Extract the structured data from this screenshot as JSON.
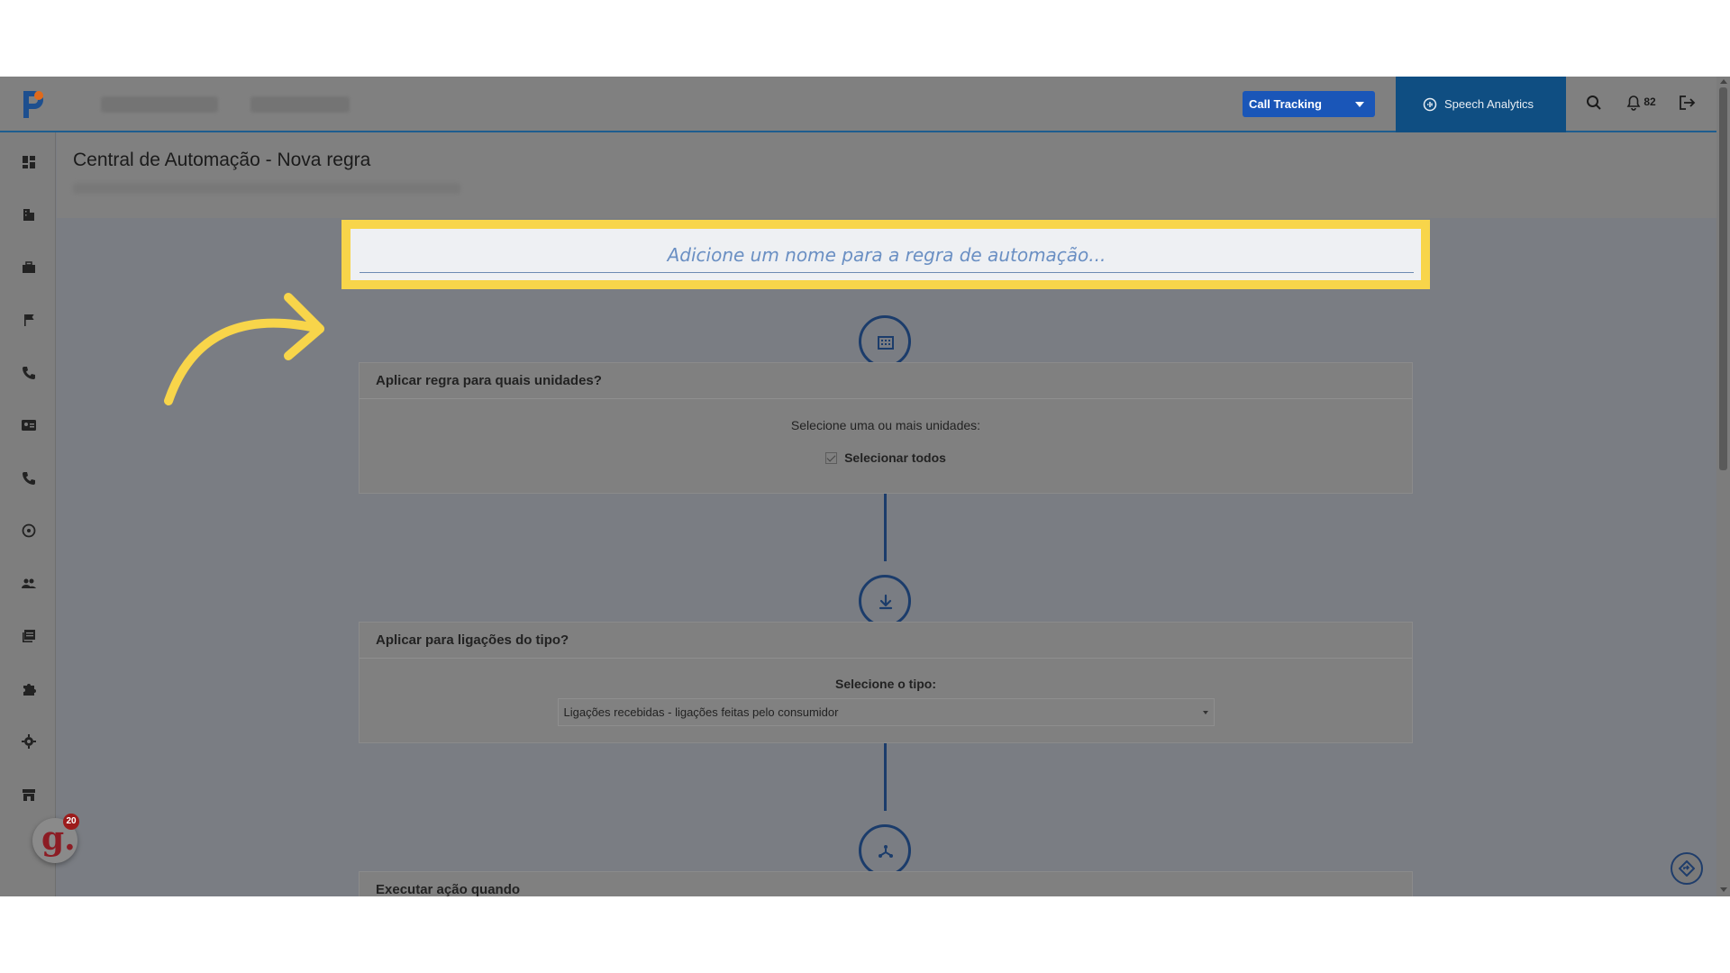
{
  "header": {
    "product_dropdown": "Call Tracking",
    "speech_tab": "Speech Analytics",
    "notifications_count": "82"
  },
  "page": {
    "title": "Central de Automação - Nova regra"
  },
  "rule_name": {
    "placeholder": "Adicione um nome para a regra de automação..."
  },
  "units_card": {
    "title": "Aplicar regra para quais unidades?",
    "subtitle": "Selecione uma ou mais unidades:",
    "select_all_label": "Selecionar todos",
    "select_all_checked": true
  },
  "type_card": {
    "title": "Aplicar para ligações do tipo?",
    "label": "Selecione o tipo:",
    "selected_value": "Ligações recebidas - ligações feitas pelo consumidor"
  },
  "action_card": {
    "title": "Executar ação quando"
  },
  "chat_widget": {
    "letter": "g.",
    "count": "20"
  },
  "colors": {
    "highlight": "#f8d54a",
    "primary_blue": "#1a56b8",
    "speech_tab": "#0f4e82",
    "step_circle": "#1b3c6b"
  },
  "icons": {
    "sidebar": [
      "dashboard-icon",
      "building-icon",
      "briefcase-icon",
      "flag-icon",
      "phone-icon",
      "contact-card-icon",
      "phone-icon",
      "gauge-icon",
      "people-icon",
      "library-icon",
      "puzzle-icon",
      "gear-icon",
      "store-icon"
    ],
    "steps": [
      "building-icon",
      "download-arrow-icon",
      "fork-icon"
    ]
  }
}
